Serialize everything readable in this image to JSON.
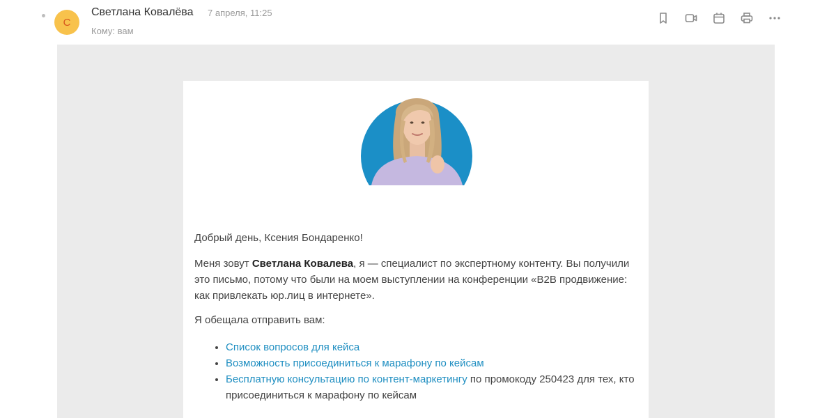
{
  "header": {
    "avatar_letter": "С",
    "sender_name": "Светлана Ковалёва",
    "date": "7 апреля, 11:25",
    "recipient": "Кому: вам",
    "toolbar_icons": [
      "bookmark-icon",
      "video-call-icon",
      "calendar-icon",
      "print-icon",
      "more-icon"
    ]
  },
  "email": {
    "greeting": "Добрый день, Ксения Бондаренко!",
    "intro_1": "Меня зовут ",
    "intro_name": "Светлана Ковалева",
    "intro_2": ", я — специалист по экспертному контенту. Вы получили это письмо, потому что были на моем выступлении на конференции «B2B продвижение: как привлекать юр.лиц в интернете».",
    "promise": "Я обещала отправить вам:",
    "items": [
      {
        "link": "Список вопросов для кейса",
        "rest": ""
      },
      {
        "link": "Возможность присоединиться к марафону по кейсам",
        "rest": ""
      },
      {
        "link": "Бесплатную консультацию по контент-маркетингу",
        "rest": " по промокоду 250423 для тех, кто присоединиться к марафону по кейсам"
      }
    ]
  },
  "colors": {
    "avatar_bg": "#f8c24c",
    "link": "#1e8ec1",
    "photo_bg": "#1b8fc7",
    "mail_bg": "#ebebeb"
  }
}
